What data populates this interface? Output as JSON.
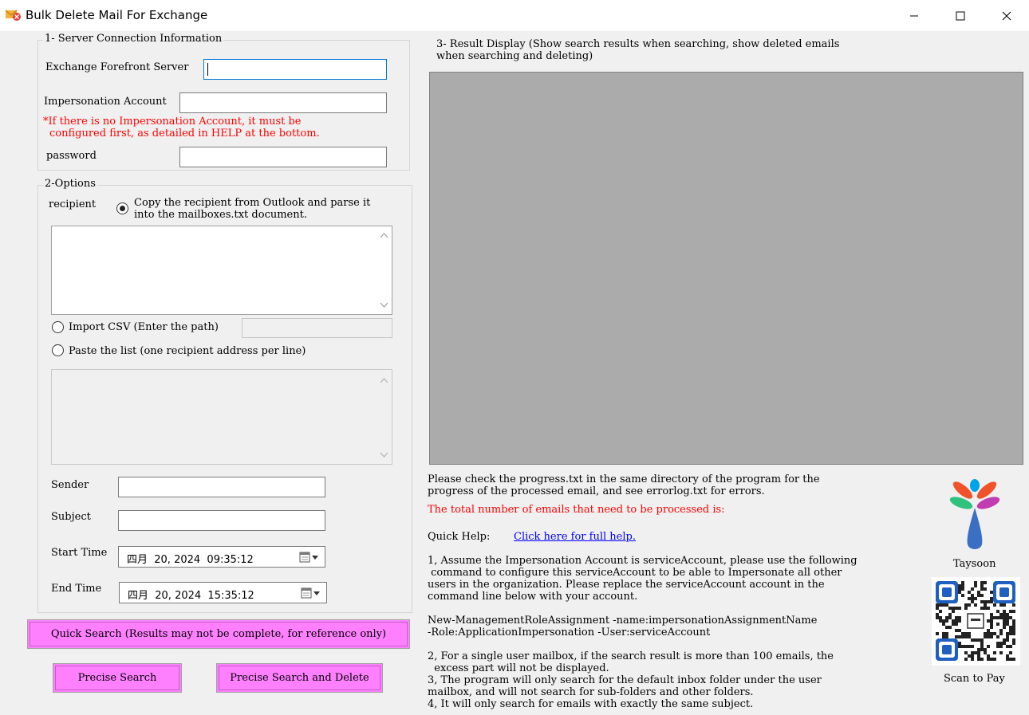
{
  "window": {
    "title": "Bulk Delete Mail For Exchange",
    "buttons": {
      "minimize": "minimize",
      "maximize": "maximize",
      "close": "close"
    }
  },
  "server": {
    "group_title": "1- Server Connection Information",
    "server_label": "Exchange Forefront Server",
    "server_value": "",
    "account_label": "Impersonation Account",
    "account_value": "",
    "warning_line1": "*If there is no Impersonation Account, it must be",
    "warning_line2": "configured first, as detailed in HELP at the bottom.",
    "password_label": "password",
    "password_value": ""
  },
  "options": {
    "group_title": "2-Options",
    "recipient_label": "recipient",
    "radio_outlook_line1": "Copy the recipient from Outlook and parse it",
    "radio_outlook_line2": "into the mailboxes.txt document.",
    "radio_csv_label": "Import CSV (Enter the path)",
    "radio_paste_label": "Paste the list (one recipient address per line)",
    "sender_label": "Sender",
    "subject_label": "Subject",
    "start_label": "Start Time",
    "start_value": "四月  20, 2024  09:35:12",
    "end_label": "End Time",
    "end_value": "四月  20, 2024  15:35:12"
  },
  "actions": {
    "quick_search": "Quick Search (Results may not be complete, for reference only)",
    "precise_search": "Precise Search",
    "precise_delete": "Precise Search and Delete"
  },
  "results": {
    "title_line1": "3- Result Display (Show search results when searching, show deleted emails",
    "title_line2": "when searching and deleting)"
  },
  "info": {
    "progress_line1": "Please check the progress.txt in the same directory of the program for the",
    "progress_line2": "progress of the processed email, and see errorlog.txt for errors.",
    "total_label": "The total number of emails that need to be processed is:",
    "quick_help_label": "Quick Help:",
    "help_link": "Click here for full help.",
    "help1": "1, Assume the Impersonation Account is serviceAccount, please use the following\n command to configure this serviceAccount to be able to Impersonate all other\nusers in the organization. Please replace the serviceAccount account in the\ncommand line below with your account.",
    "cmd": "New-ManagementRoleAssignment -name:impersonationAssignmentName\n-Role:ApplicationImpersonation -User:serviceAccount",
    "help2": "2, For a single user mailbox, if the search result is more than 100 emails, the\n  excess part will not be displayed.",
    "help3": "3, The program will only search for the default inbox folder under the user\nmailbox, and will not search for sub-folders and other folders.",
    "help4": "4, It will only search for emails with exactly the same subject."
  },
  "brand": {
    "name": "Taysoon",
    "scan_label": "Scan to Pay",
    "colors": [
      "#f0522a",
      "#2ec27e",
      "#c03cb0",
      "#00a2e8",
      "#3a6fc4"
    ]
  }
}
